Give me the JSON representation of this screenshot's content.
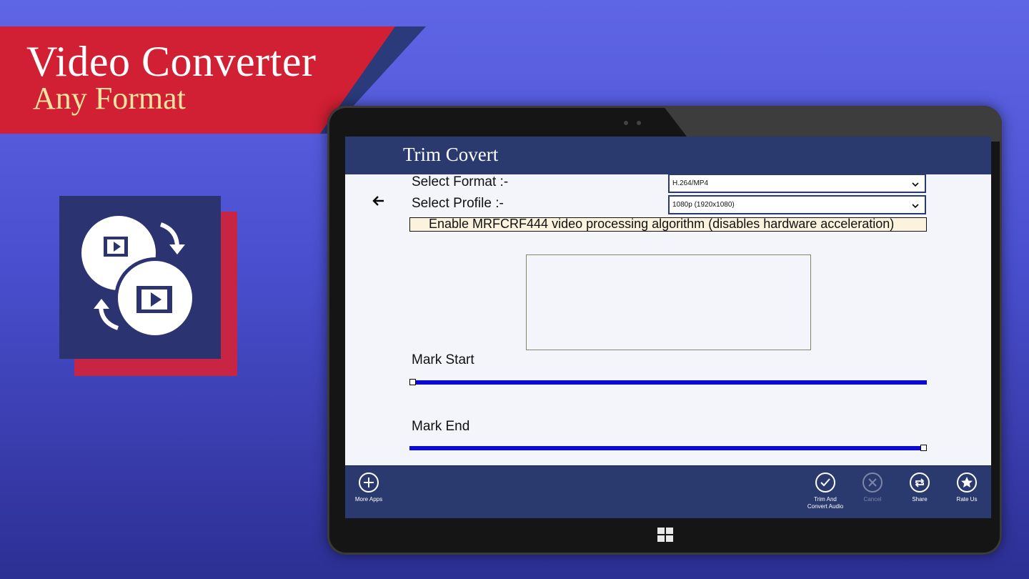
{
  "banner": {
    "title": "Video Converter",
    "subtitle": "Any Format"
  },
  "page": {
    "title": "Trim Covert"
  },
  "form": {
    "format_label": "Select Format :-",
    "format_value": "H.264/MP4",
    "profile_label": "Select Profile :-",
    "profile_value": "1080p (1920x1080)",
    "checkbox_label": "Enable MRFCRF444 video processing algorithm (disables hardware acceleration)",
    "checkbox_checked": false
  },
  "sliders": {
    "mark_start_label": "Mark Start",
    "mark_start_value": 0,
    "mark_end_label": "Mark End",
    "mark_end_value": 1
  },
  "app_bar": {
    "more_apps": "More Apps",
    "trim_convert_line1": "Trim And",
    "trim_convert_line2": "Convert Audio",
    "cancel": "Cancel",
    "share": "Share",
    "rate_us": "Rate Us"
  },
  "colors": {
    "banner_red": "#d11f33",
    "navy": "#2b3a6e",
    "slider_blue": "#0a0ad2",
    "subtitle_gold": "#f6e3a0"
  },
  "icons": [
    "back-arrow-icon",
    "chevron-down-icon",
    "plus-icon",
    "checkmark-icon",
    "close-icon",
    "share-icon",
    "star-icon",
    "windows-logo-icon",
    "video-convert-icon"
  ]
}
